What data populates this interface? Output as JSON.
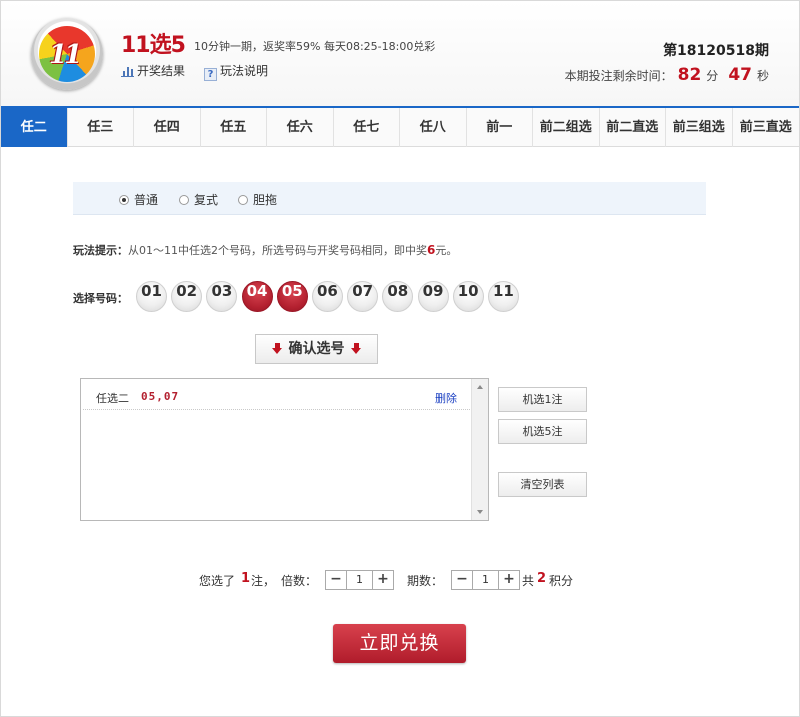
{
  "header": {
    "title": "11选5",
    "subtitle": "10分钟一期，返奖率59% 每天08:25-18:00兑彩",
    "logo_text": "11",
    "links": [
      {
        "label": "开奖结果",
        "icon": "bar-chart-icon"
      },
      {
        "label": "玩法说明",
        "icon": "help-icon"
      }
    ],
    "issue": "第18120518期",
    "countdown": {
      "label": "本期投注剩余时间：",
      "minutes": "82",
      "min_unit": "分",
      "seconds": "47",
      "sec_unit": "秒"
    }
  },
  "tabs": [
    "任二",
    "任三",
    "任四",
    "任五",
    "任六",
    "任七",
    "任八",
    "前一",
    "前二组选",
    "前二直选",
    "前三组选",
    "前三直选"
  ],
  "active_tab": "任二",
  "modes": [
    {
      "label": "普通",
      "selected": true
    },
    {
      "label": "复式",
      "selected": false
    },
    {
      "label": "胆拖",
      "selected": false
    }
  ],
  "tip": {
    "label": "玩法提示：",
    "text": "从01～11中任选2个号码，所选号码与开奖号码相同，即中奖",
    "prize": "6",
    "unit": "元。"
  },
  "pick": {
    "label": "选择号码：",
    "numbers": [
      "01",
      "02",
      "03",
      "04",
      "05",
      "06",
      "07",
      "08",
      "09",
      "10",
      "11"
    ],
    "selected": [
      "04",
      "05"
    ]
  },
  "confirm_label": "确认选号",
  "selection_list": [
    {
      "type": "任选二",
      "numbers": "05,07",
      "delete_label": "删除"
    }
  ],
  "side_buttons": {
    "random1": "机选1注",
    "random5": "机选5注",
    "clear": "清空列表"
  },
  "summary": {
    "prefix": "您选了",
    "count": "1",
    "count_unit": "注，",
    "multiple_label": "倍数：",
    "multiple_value": "1",
    "periods_label": "期数：",
    "periods_value": "1",
    "total_prefix": "共",
    "total": "2",
    "total_unit": "积分",
    "minus": "−",
    "plus": "+"
  },
  "exchange_label": "立即兑换",
  "colors": {
    "brand_red": "#c1121f",
    "tab_blue": "#1a67c7",
    "link_blue": "#1a3fc2"
  }
}
